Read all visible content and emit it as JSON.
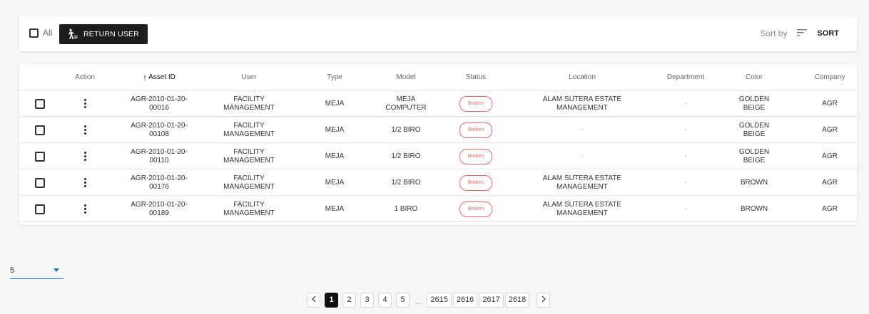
{
  "toolbar": {
    "all_label": "All",
    "return_label": "RETURN USER",
    "sort_by_label": "Sort by",
    "sort_label": "SORT"
  },
  "table": {
    "headers": {
      "action": "Action",
      "asset_id": "Asset ID",
      "user": "User",
      "type": "Type",
      "model": "Model",
      "status": "Status",
      "location": "Location",
      "department": "Department",
      "color": "Color",
      "company": "Company"
    },
    "sort_arrow": "↑",
    "rows": [
      {
        "asset_id": "AGR-2010-01-20-\n00016",
        "user": "FACILITY\nMANAGEMENT",
        "type": "MEJA",
        "model": "MEJA\nCOMPUTER",
        "status": "Broken",
        "location": "ALAM SUTERA ESTATE\nMANAGEMENT",
        "department": "-",
        "color": "GOLDEN\nBEIGE",
        "company": "AGR"
      },
      {
        "asset_id": "AGR-2010-01-20-\n00108",
        "user": "FACILITY\nMANAGEMENT",
        "type": "MEJA",
        "model": "1/2 BIRO",
        "status": "Broken",
        "location": "-",
        "department": "-",
        "color": "GOLDEN\nBEIGE",
        "company": "AGR"
      },
      {
        "asset_id": "AGR-2010-01-20-\n00110",
        "user": "FACILITY\nMANAGEMENT",
        "type": "MEJA",
        "model": "1/2 BIRO",
        "status": "Broken",
        "location": "-",
        "department": "-",
        "color": "GOLDEN\nBEIGE",
        "company": "AGR"
      },
      {
        "asset_id": "AGR-2010-01-20-\n00176",
        "user": "FACILITY\nMANAGEMENT",
        "type": "MEJA",
        "model": "1/2 BIRO",
        "status": "Broken",
        "location": "ALAM SUTERA ESTATE\nMANAGEMENT",
        "department": "-",
        "color": "BROWN",
        "company": "AGR"
      },
      {
        "asset_id": "AGR-2010-01-20-\n00189",
        "user": "FACILITY\nMANAGEMENT",
        "type": "MEJA",
        "model": "1 BIRO",
        "status": "Broken",
        "location": "ALAM SUTERA ESTATE\nMANAGEMENT",
        "department": "-",
        "color": "BROWN",
        "company": "AGR"
      }
    ]
  },
  "pagination": {
    "per_page": "5",
    "prev": "<",
    "next": ">",
    "pages": [
      "1",
      "2",
      "3",
      "4",
      "5"
    ],
    "ellipsis": "...",
    "last_pages": [
      "2615",
      "2616",
      "2617",
      "2618"
    ],
    "active_page": "1"
  },
  "colors": {
    "accent": "#1a73e8",
    "status_broken": "#e26b6b",
    "button_dark": "#1d1d1d"
  },
  "icons": {
    "row_action": "more-vertical-icon",
    "sort": "sort-lines-icon",
    "return": "walking-person-icon"
  }
}
